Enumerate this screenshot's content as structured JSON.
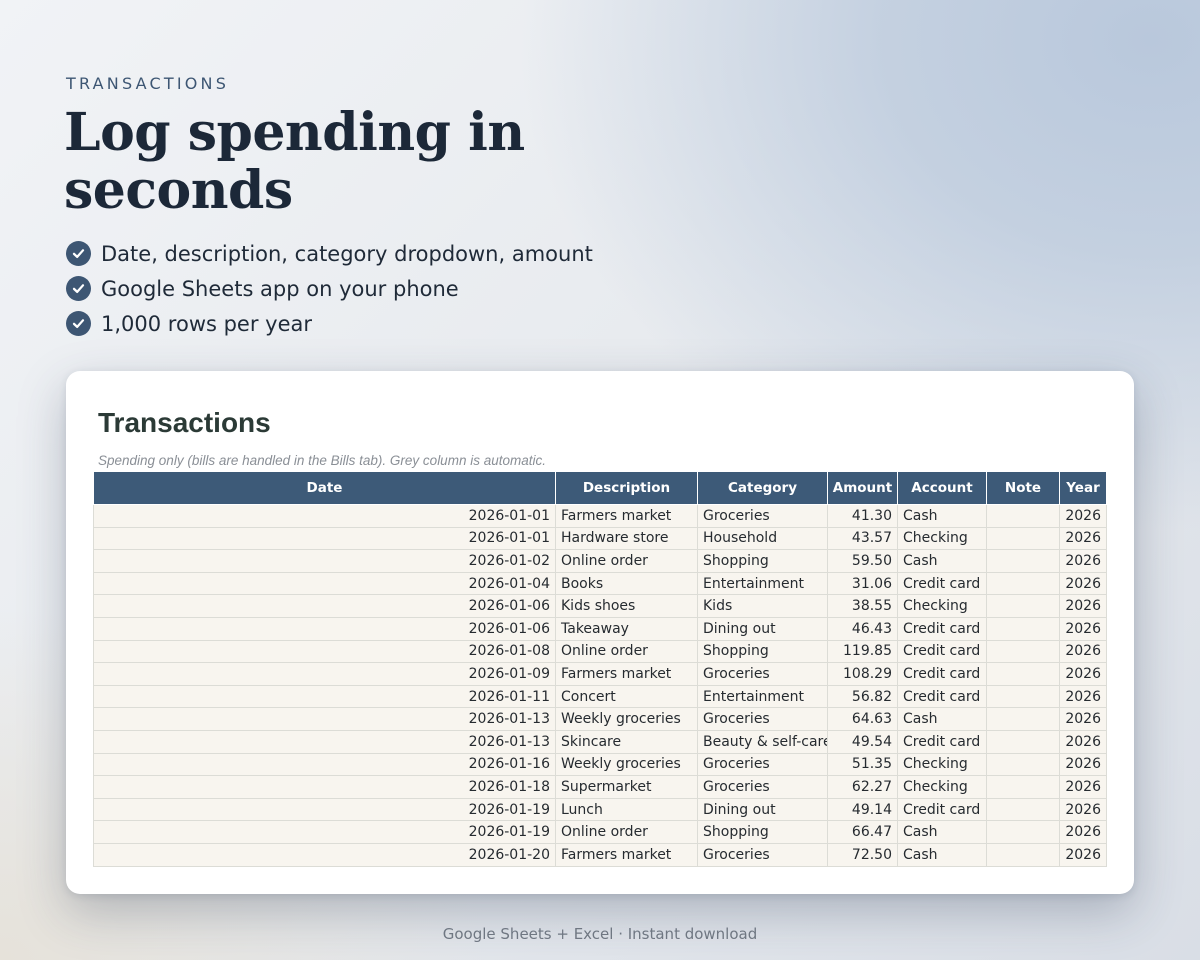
{
  "hero": {
    "eyebrow": "TRANSACTIONS",
    "headline": "Log spending in seconds",
    "features": [
      "Date, description, category dropdown, amount",
      "Google Sheets app on your phone",
      "1,000 rows per year"
    ]
  },
  "sheet": {
    "title": "Transactions",
    "note": "Spending only (bills are handled in the Bills tab). Grey column is automatic.",
    "columns": [
      "Date",
      "Description",
      "Category",
      "Amount",
      "Account",
      "Note",
      "Year"
    ],
    "rows": [
      {
        "date": "2026-01-01",
        "description": "Farmers market",
        "category": "Groceries",
        "amount": "41.30",
        "account": "Cash",
        "note": "",
        "year": "2026"
      },
      {
        "date": "2026-01-01",
        "description": "Hardware store",
        "category": "Household",
        "amount": "43.57",
        "account": "Checking",
        "note": "",
        "year": "2026"
      },
      {
        "date": "2026-01-02",
        "description": "Online order",
        "category": "Shopping",
        "amount": "59.50",
        "account": "Cash",
        "note": "",
        "year": "2026"
      },
      {
        "date": "2026-01-04",
        "description": "Books",
        "category": "Entertainment",
        "amount": "31.06",
        "account": "Credit card",
        "note": "",
        "year": "2026"
      },
      {
        "date": "2026-01-06",
        "description": "Kids shoes",
        "category": "Kids",
        "amount": "38.55",
        "account": "Checking",
        "note": "",
        "year": "2026"
      },
      {
        "date": "2026-01-06",
        "description": "Takeaway",
        "category": "Dining out",
        "amount": "46.43",
        "account": "Credit card",
        "note": "",
        "year": "2026"
      },
      {
        "date": "2026-01-08",
        "description": "Online order",
        "category": "Shopping",
        "amount": "119.85",
        "account": "Credit card",
        "note": "",
        "year": "2026"
      },
      {
        "date": "2026-01-09",
        "description": "Farmers market",
        "category": "Groceries",
        "amount": "108.29",
        "account": "Credit card",
        "note": "",
        "year": "2026"
      },
      {
        "date": "2026-01-11",
        "description": "Concert",
        "category": "Entertainment",
        "amount": "56.82",
        "account": "Credit card",
        "note": "",
        "year": "2026"
      },
      {
        "date": "2026-01-13",
        "description": "Weekly groceries",
        "category": "Groceries",
        "amount": "64.63",
        "account": "Cash",
        "note": "",
        "year": "2026"
      },
      {
        "date": "2026-01-13",
        "description": "Skincare",
        "category": "Beauty & self-care",
        "amount": "49.54",
        "account": "Credit card",
        "note": "",
        "year": "2026"
      },
      {
        "date": "2026-01-16",
        "description": "Weekly groceries",
        "category": "Groceries",
        "amount": "51.35",
        "account": "Checking",
        "note": "",
        "year": "2026"
      },
      {
        "date": "2026-01-18",
        "description": "Supermarket",
        "category": "Groceries",
        "amount": "62.27",
        "account": "Checking",
        "note": "",
        "year": "2026"
      },
      {
        "date": "2026-01-19",
        "description": "Lunch",
        "category": "Dining out",
        "amount": "49.14",
        "account": "Credit card",
        "note": "",
        "year": "2026"
      },
      {
        "date": "2026-01-19",
        "description": "Online order",
        "category": "Shopping",
        "amount": "66.47",
        "account": "Cash",
        "note": "",
        "year": "2026"
      },
      {
        "date": "2026-01-20",
        "description": "Farmers market",
        "category": "Groceries",
        "amount": "72.50",
        "account": "Cash",
        "note": "",
        "year": "2026"
      }
    ]
  },
  "footer": {
    "text": "Google Sheets + Excel  ·  Instant download"
  },
  "colors": {
    "accent": "#3d5673",
    "header_bg": "#3d5a78",
    "cell_bg": "#f8f5ef",
    "headline": "#1c2838"
  },
  "icons": {
    "feature_bullet": "check-circle-icon"
  }
}
